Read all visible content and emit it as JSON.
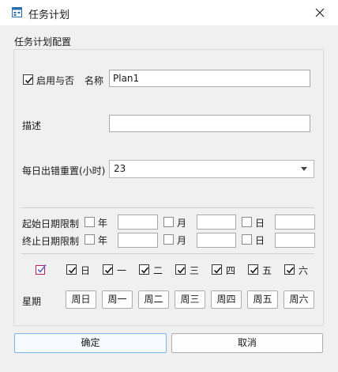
{
  "window": {
    "title": "任务计划"
  },
  "group": {
    "title": "任务计划配置"
  },
  "enable": {
    "label": "启用与否",
    "checked": true
  },
  "name": {
    "label": "名称",
    "value": "Plan1"
  },
  "description": {
    "label": "描述",
    "value": ""
  },
  "daily_reset": {
    "label": "每日出错重置(小时)",
    "value": "23"
  },
  "start_limit": {
    "label": "起始日期限制",
    "year": "年",
    "month": "月",
    "day": "日"
  },
  "end_limit": {
    "label": "终止日期限制",
    "year": "年",
    "month": "月",
    "day": "日"
  },
  "weekdays": [
    {
      "label": "日",
      "checked": true
    },
    {
      "label": "一",
      "checked": true
    },
    {
      "label": "二",
      "checked": true
    },
    {
      "label": "三",
      "checked": true
    },
    {
      "label": "四",
      "checked": true
    },
    {
      "label": "五",
      "checked": true
    },
    {
      "label": "六",
      "checked": true
    }
  ],
  "week": {
    "label": "星期",
    "buttons": [
      "周日",
      "周一",
      "周二",
      "周三",
      "周四",
      "周五",
      "周六"
    ]
  },
  "footer": {
    "ok_label": "确定",
    "cancel_label": "取消"
  },
  "colors": {
    "accent": "#7eb4ea",
    "select_all_icon": "#c2185b"
  }
}
